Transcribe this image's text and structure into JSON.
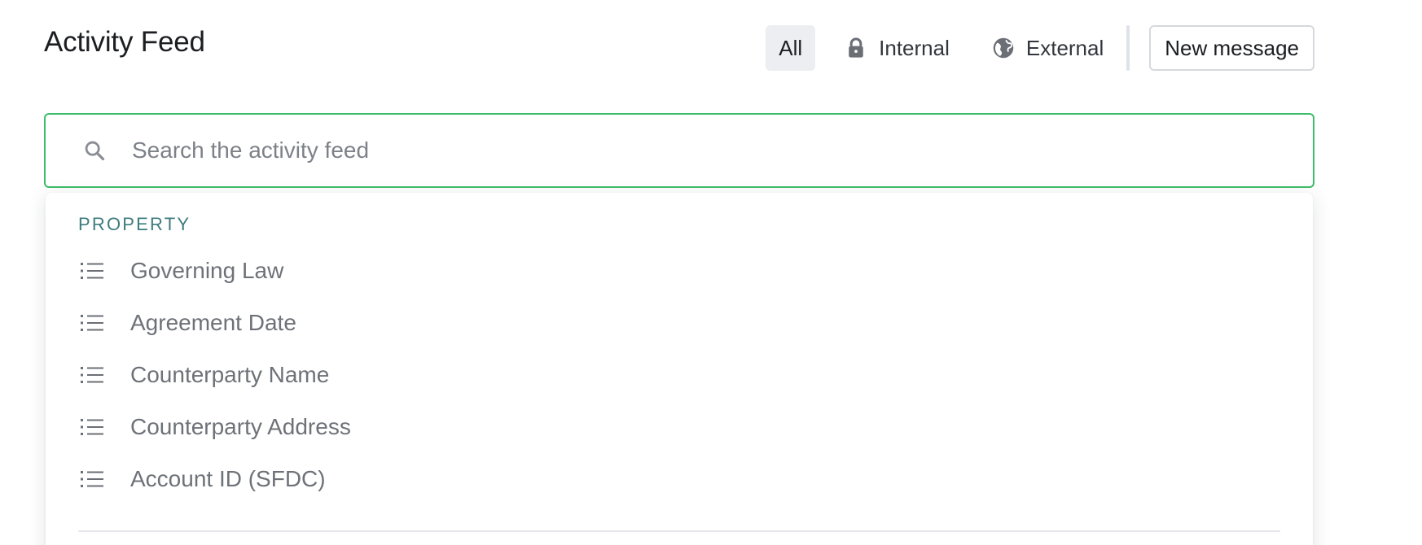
{
  "header": {
    "title": "Activity Feed"
  },
  "filters": {
    "all_label": "All",
    "internal_label": "Internal",
    "internal_icon": "lock-icon",
    "external_label": "External",
    "external_icon": "globe-icon",
    "new_message_label": "New message"
  },
  "search": {
    "placeholder": "Search the activity feed",
    "value": "",
    "icon": "search-icon",
    "focus_color": "#3ebd6b"
  },
  "dropdown": {
    "section_label": "PROPERTY",
    "section_color": "#3e7b7e",
    "item_icon": "list-icon",
    "items": [
      {
        "label": "Governing Law"
      },
      {
        "label": "Agreement Date"
      },
      {
        "label": "Counterparty Name"
      },
      {
        "label": "Counterparty Address"
      },
      {
        "label": "Account ID (SFDC)"
      }
    ]
  }
}
